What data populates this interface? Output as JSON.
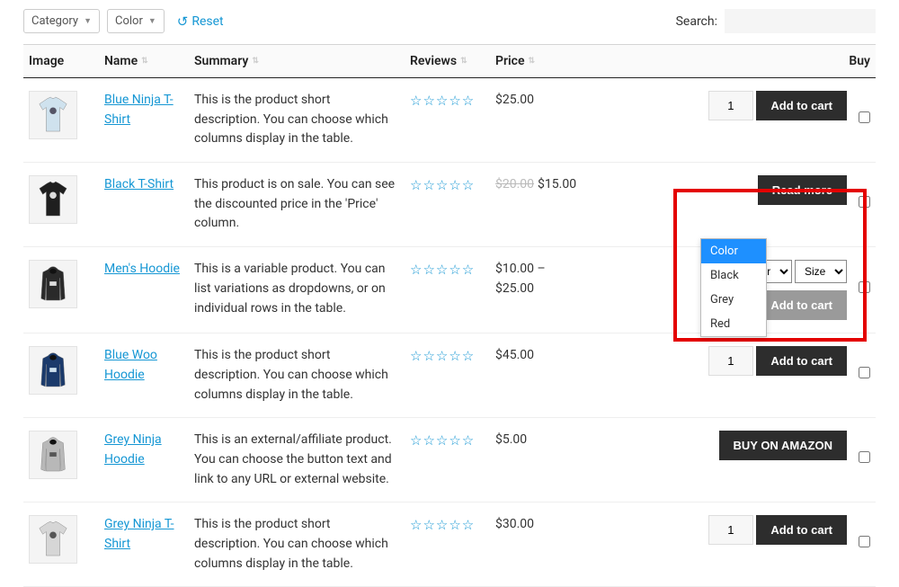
{
  "filters": {
    "category_label": "Category",
    "color_label": "Color",
    "reset_label": "Reset"
  },
  "search": {
    "label": "Search:"
  },
  "columns": {
    "image": "Image",
    "name": "Name",
    "summary": "Summary",
    "reviews": "Reviews",
    "price": "Price",
    "buy": "Buy"
  },
  "buttons": {
    "add": "Add to cart",
    "read_more": "Read more",
    "amazon": "BUY ON AMAZON"
  },
  "variation": {
    "color": "Color",
    "size": "Size"
  },
  "dropdown_options": [
    "Color",
    "Black",
    "Grey",
    "Red"
  ],
  "rows": [
    {
      "name": "Blue Ninja T-Shirt",
      "summary": "This is the product short description. You can choose which columns display in the table.",
      "price": "$25.00",
      "qty": "1",
      "action": "add",
      "thumb": "tee",
      "fill": "#cfe2ee",
      "ink": "#556"
    },
    {
      "name": "Black T-Shirt",
      "summary": "This product is on sale. You can see the discounted price in the 'Price' column.",
      "old": "$20.00",
      "price": "$15.00",
      "action": "read_more",
      "thumb": "tee",
      "fill": "#1f1f1f",
      "ink": "#ddd"
    },
    {
      "name": "Men's Hoodie",
      "summary": "This is a variable product. You can list variations as dropdowns, or on individual rows in the table.",
      "price": "$10.00 – $25.00",
      "action": "variable",
      "thumb": "hoodie",
      "fill": "#2a2a2a",
      "ink": "#ddd"
    },
    {
      "name": "Blue Woo Hoodie",
      "summary": "This is the product short description. You can choose which columns display in the table.",
      "price": "$45.00",
      "qty": "1",
      "action": "add",
      "thumb": "hoodie",
      "fill": "#1b3a6b",
      "ink": "#cfe2ee"
    },
    {
      "name": "Grey Ninja Hoodie",
      "summary": "This is an external/affiliate product. You can choose the button text and link to any URL or external website.",
      "price": "$5.00",
      "action": "amazon",
      "thumb": "hoodie",
      "fill": "#b8b8b8",
      "ink": "#555"
    },
    {
      "name": "Grey Ninja T-Shirt",
      "summary": "This is the product short description. You can choose which columns display in the table.",
      "price": "$30.00",
      "qty": "1",
      "action": "add",
      "thumb": "tee",
      "fill": "#d6d6d6",
      "ink": "#555"
    }
  ]
}
